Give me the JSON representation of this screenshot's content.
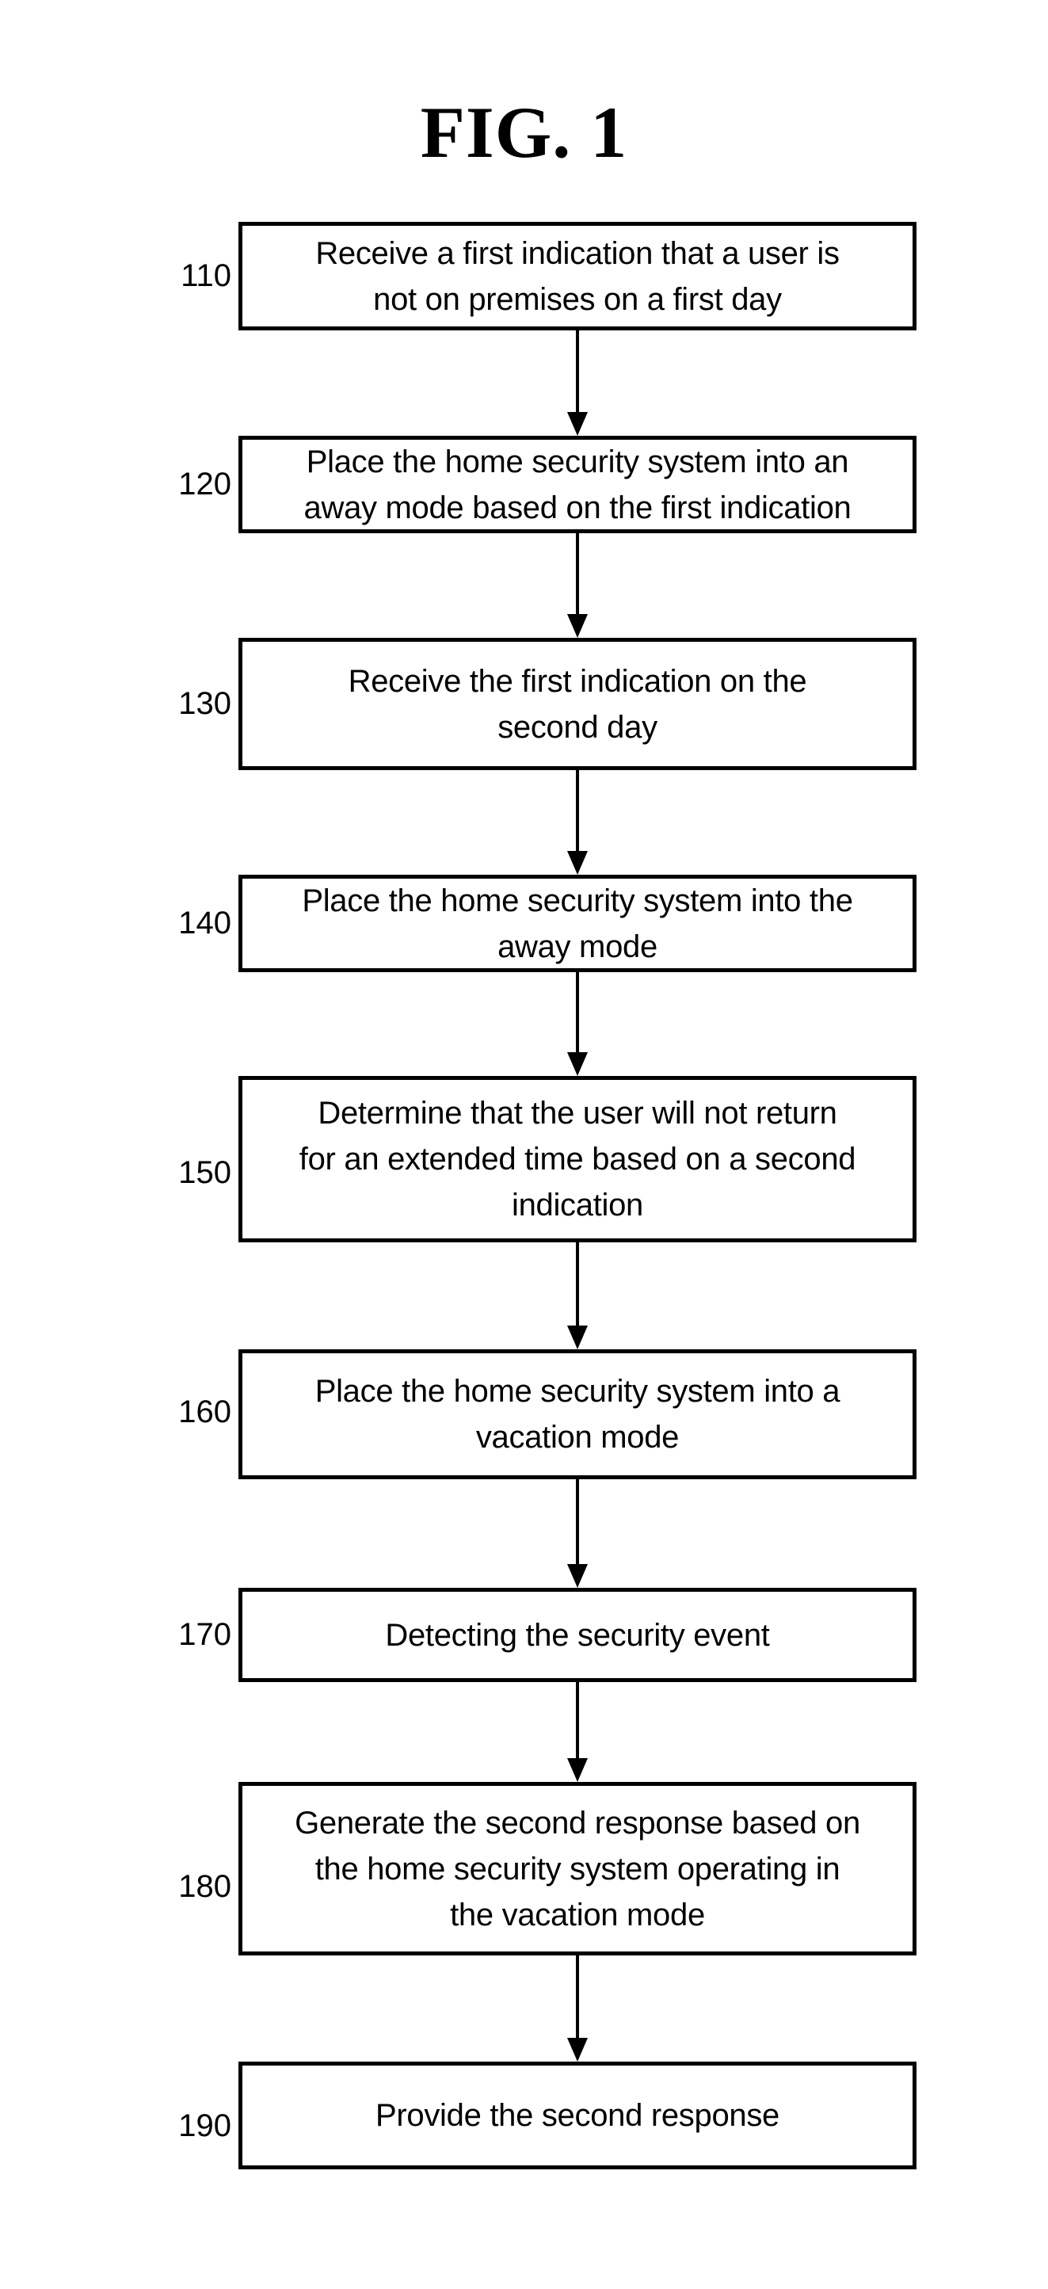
{
  "figure": {
    "title": "FIG. 1"
  },
  "steps": [
    {
      "number": "110",
      "text": "Receive a first indication that a user is\nnot on premises on a first day"
    },
    {
      "number": "120",
      "text": "Place the home security system into an\naway mode based on the first indication"
    },
    {
      "number": "130",
      "text": "Receive the first indication on the\nsecond day"
    },
    {
      "number": "140",
      "text": "Place the home security system into the\naway mode"
    },
    {
      "number": "150",
      "text": "Determine that the user will not return\nfor an extended time based on a second\nindication"
    },
    {
      "number": "160",
      "text": "Place the home security system into a\nvacation mode"
    },
    {
      "number": "170",
      "text": "Detecting the security event"
    },
    {
      "number": "180",
      "text": "Generate the second response based on\nthe home security system operating in\nthe vacation mode"
    },
    {
      "number": "190",
      "text": "Provide the second response"
    }
  ],
  "flow": [
    {
      "from": "110",
      "to": "120"
    },
    {
      "from": "120",
      "to": "130"
    },
    {
      "from": "130",
      "to": "140"
    },
    {
      "from": "140",
      "to": "150"
    },
    {
      "from": "150",
      "to": "160"
    },
    {
      "from": "160",
      "to": "170"
    },
    {
      "from": "170",
      "to": "180"
    },
    {
      "from": "180",
      "to": "190"
    }
  ]
}
